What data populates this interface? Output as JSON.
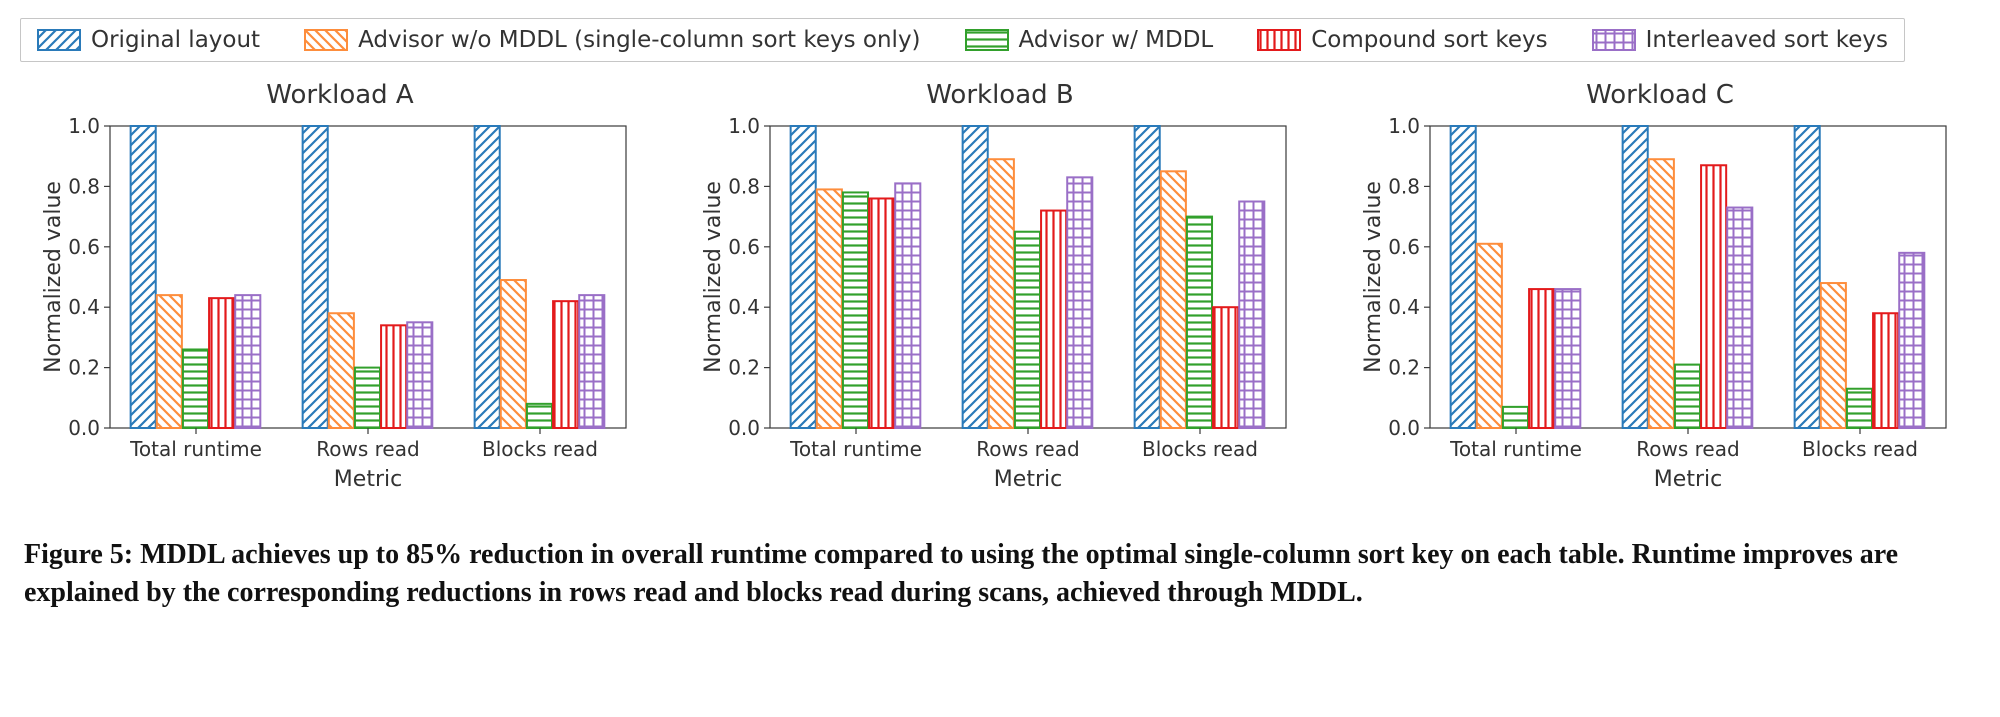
{
  "chart_data": [
    {
      "type": "bar",
      "title": "Workload A",
      "xlabel": "Metric",
      "ylabel": "Normalized value",
      "ylim": [
        0.0,
        1.0
      ],
      "yticks": [
        0.0,
        0.2,
        0.4,
        0.6,
        0.8,
        1.0
      ],
      "categories": [
        "Total runtime",
        "Rows read",
        "Blocks read"
      ],
      "series": [
        {
          "name": "Original layout",
          "values": [
            1.0,
            1.0,
            1.0
          ]
        },
        {
          "name": "Advisor w/o MDDL (single-column sort keys only)",
          "values": [
            0.44,
            0.38,
            0.49
          ]
        },
        {
          "name": "Advisor w/ MDDL",
          "values": [
            0.26,
            0.2,
            0.08
          ]
        },
        {
          "name": "Compound sort keys",
          "values": [
            0.43,
            0.34,
            0.42
          ]
        },
        {
          "name": "Interleaved sort keys",
          "values": [
            0.44,
            0.35,
            0.44
          ]
        }
      ]
    },
    {
      "type": "bar",
      "title": "Workload B",
      "xlabel": "Metric",
      "ylabel": "Normalized value",
      "ylim": [
        0.0,
        1.0
      ],
      "yticks": [
        0.0,
        0.2,
        0.4,
        0.6,
        0.8,
        1.0
      ],
      "categories": [
        "Total runtime",
        "Rows read",
        "Blocks read"
      ],
      "series": [
        {
          "name": "Original layout",
          "values": [
            1.0,
            1.0,
            1.0
          ]
        },
        {
          "name": "Advisor w/o MDDL (single-column sort keys only)",
          "values": [
            0.79,
            0.89,
            0.85
          ]
        },
        {
          "name": "Advisor w/ MDDL",
          "values": [
            0.78,
            0.65,
            0.7
          ]
        },
        {
          "name": "Compound sort keys",
          "values": [
            0.76,
            0.72,
            0.4
          ]
        },
        {
          "name": "Interleaved sort keys",
          "values": [
            0.81,
            0.83,
            0.75
          ]
        }
      ]
    },
    {
      "type": "bar",
      "title": "Workload C",
      "xlabel": "Metric",
      "ylabel": "Normalized value",
      "ylim": [
        0.0,
        1.0
      ],
      "yticks": [
        0.0,
        0.2,
        0.4,
        0.6,
        0.8,
        1.0
      ],
      "categories": [
        "Total runtime",
        "Rows read",
        "Blocks read"
      ],
      "series": [
        {
          "name": "Original layout",
          "values": [
            1.0,
            1.0,
            1.0
          ]
        },
        {
          "name": "Advisor w/o MDDL (single-column sort keys only)",
          "values": [
            0.61,
            0.89,
            0.48
          ]
        },
        {
          "name": "Advisor w/ MDDL",
          "values": [
            0.07,
            0.21,
            0.13
          ]
        },
        {
          "name": "Compound sort keys",
          "values": [
            0.46,
            0.87,
            0.38
          ]
        },
        {
          "name": "Interleaved sort keys",
          "values": [
            0.46,
            0.73,
            0.58
          ]
        }
      ]
    }
  ],
  "legend": {
    "items": [
      {
        "label": "Original layout",
        "pattern": "blue"
      },
      {
        "label": "Advisor w/o MDDL (single-column sort keys only)",
        "pattern": "orange"
      },
      {
        "label": "Advisor w/ MDDL",
        "pattern": "green"
      },
      {
        "label": "Compound sort keys",
        "pattern": "red"
      },
      {
        "label": "Interleaved sort keys",
        "pattern": "purple"
      }
    ]
  },
  "caption": {
    "text": "Figure 5: MDDL achieves up to 85% reduction in overall runtime compared to using the optimal single-column sort key on each table. Runtime improves are explained by the corresponding reductions in rows read and blocks read during scans, achieved through MDDL."
  },
  "colors": {
    "blue": "#2a7ab9",
    "orange": "#fd8d3c",
    "green": "#32a02c",
    "red": "#e31a1c",
    "purple": "#9a6fc7"
  }
}
